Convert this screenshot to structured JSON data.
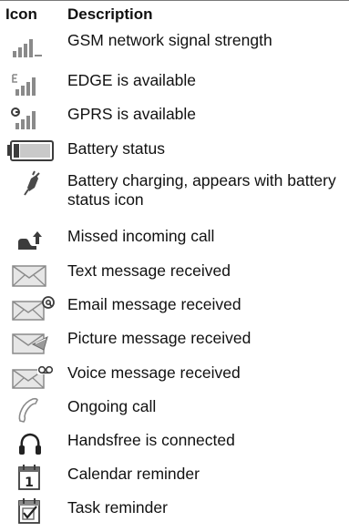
{
  "header": {
    "icon": "Icon",
    "description": "Description"
  },
  "rows": [
    {
      "icon": "signal-strength-icon",
      "description": "GSM network signal strength"
    },
    {
      "icon": "edge-signal-icon",
      "description": "EDGE is available"
    },
    {
      "icon": "gprs-signal-icon",
      "description": "GPRS is available"
    },
    {
      "icon": "battery-icon",
      "description": "Battery status"
    },
    {
      "icon": "charging-plug-icon",
      "description": "Battery charging, appears with battery status icon"
    },
    {
      "icon": "missed-call-icon",
      "description": "Missed incoming call"
    },
    {
      "icon": "envelope-icon",
      "description": "Text message received"
    },
    {
      "icon": "envelope-at-icon",
      "description": "Email message received"
    },
    {
      "icon": "envelope-picture-icon",
      "description": "Picture message received"
    },
    {
      "icon": "envelope-voicemail-icon",
      "description": "Voice message received"
    },
    {
      "icon": "phone-handset-icon",
      "description": "Ongoing call"
    },
    {
      "icon": "headset-icon",
      "description": "Handsfree is connected"
    },
    {
      "icon": "calendar-icon",
      "description": "Calendar reminder"
    },
    {
      "icon": "task-checkbox-icon",
      "description": "Task reminder"
    }
  ],
  "calendar_icon_day": "1",
  "colors": {
    "icon_gray": "#8a8a8a",
    "icon_dark": "#3c3c3c",
    "rule": "#7a7a7a"
  }
}
